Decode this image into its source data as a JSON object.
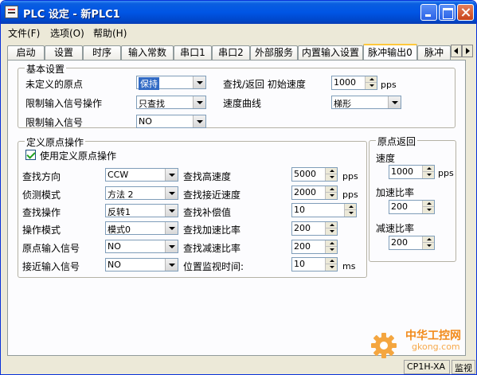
{
  "window": {
    "title": "PLC 设定 - 新PLC1"
  },
  "menu": {
    "items": [
      "文件(F)",
      "选项(O)",
      "帮助(H)"
    ]
  },
  "tabs": [
    "启动",
    "设置",
    "时序",
    "输入常数",
    "串口1",
    "串口2",
    "外部服务",
    "内置输入设置",
    "脉冲输出0",
    "脉冲"
  ],
  "active_tab": "脉冲输出0",
  "basic": {
    "legend": "基本设置",
    "undef_origin": {
      "label": "未定义的原点",
      "value": "保持"
    },
    "limit_op": {
      "label": "限制输入信号操作",
      "value": "只查找"
    },
    "limit_signal": {
      "label": "限制输入信号",
      "value": "NO"
    },
    "init_speed": {
      "label": "查找/返回 初始速度",
      "value": "1000",
      "unit": "pps"
    },
    "speed_curve": {
      "label": "速度曲线",
      "value": "梯形"
    }
  },
  "define": {
    "checkbox_label": "使用定义原点操作",
    "checked": true,
    "legend": "定义原点操作",
    "search_dir": {
      "label": "查找方向",
      "value": "CCW"
    },
    "detect_mode": {
      "label": "侦测模式",
      "value": "方法 2"
    },
    "search_op": {
      "label": "查找操作",
      "value": "反转1"
    },
    "op_mode": {
      "label": "操作模式",
      "value": "模式0"
    },
    "origin_signal": {
      "label": "原点输入信号",
      "value": "NO"
    },
    "near_signal": {
      "label": "接近输入信号",
      "value": "NO"
    },
    "high_speed": {
      "label": "查找高速度",
      "value": "5000",
      "unit": "pps"
    },
    "near_speed": {
      "label": "查找接近速度",
      "value": "2000",
      "unit": "pps"
    },
    "comp_value": {
      "label": "查找补偿值",
      "value": "10"
    },
    "accel_ratio": {
      "label": "查找加速比率",
      "value": "200"
    },
    "decel_ratio": {
      "label": "查找减速比率",
      "value": "200"
    },
    "monitor_time": {
      "label": "位置监视时间:",
      "value": "10",
      "unit": "ms"
    }
  },
  "origin_return": {
    "legend": "原点返回",
    "speed": {
      "label": "速度",
      "value": "1000",
      "unit": "pps"
    },
    "accel": {
      "label": "加速比率",
      "value": "200"
    },
    "decel": {
      "label": "减速比率",
      "value": "200"
    }
  },
  "status": {
    "model": "CP1H-XA",
    "mode": "监视"
  },
  "watermark": {
    "text": "中华工控网",
    "url": "gkong.com"
  },
  "colors": {
    "titlebar": "#0055e5",
    "accent_tab": "#ffc83c",
    "watermark": "#f28a1a"
  }
}
